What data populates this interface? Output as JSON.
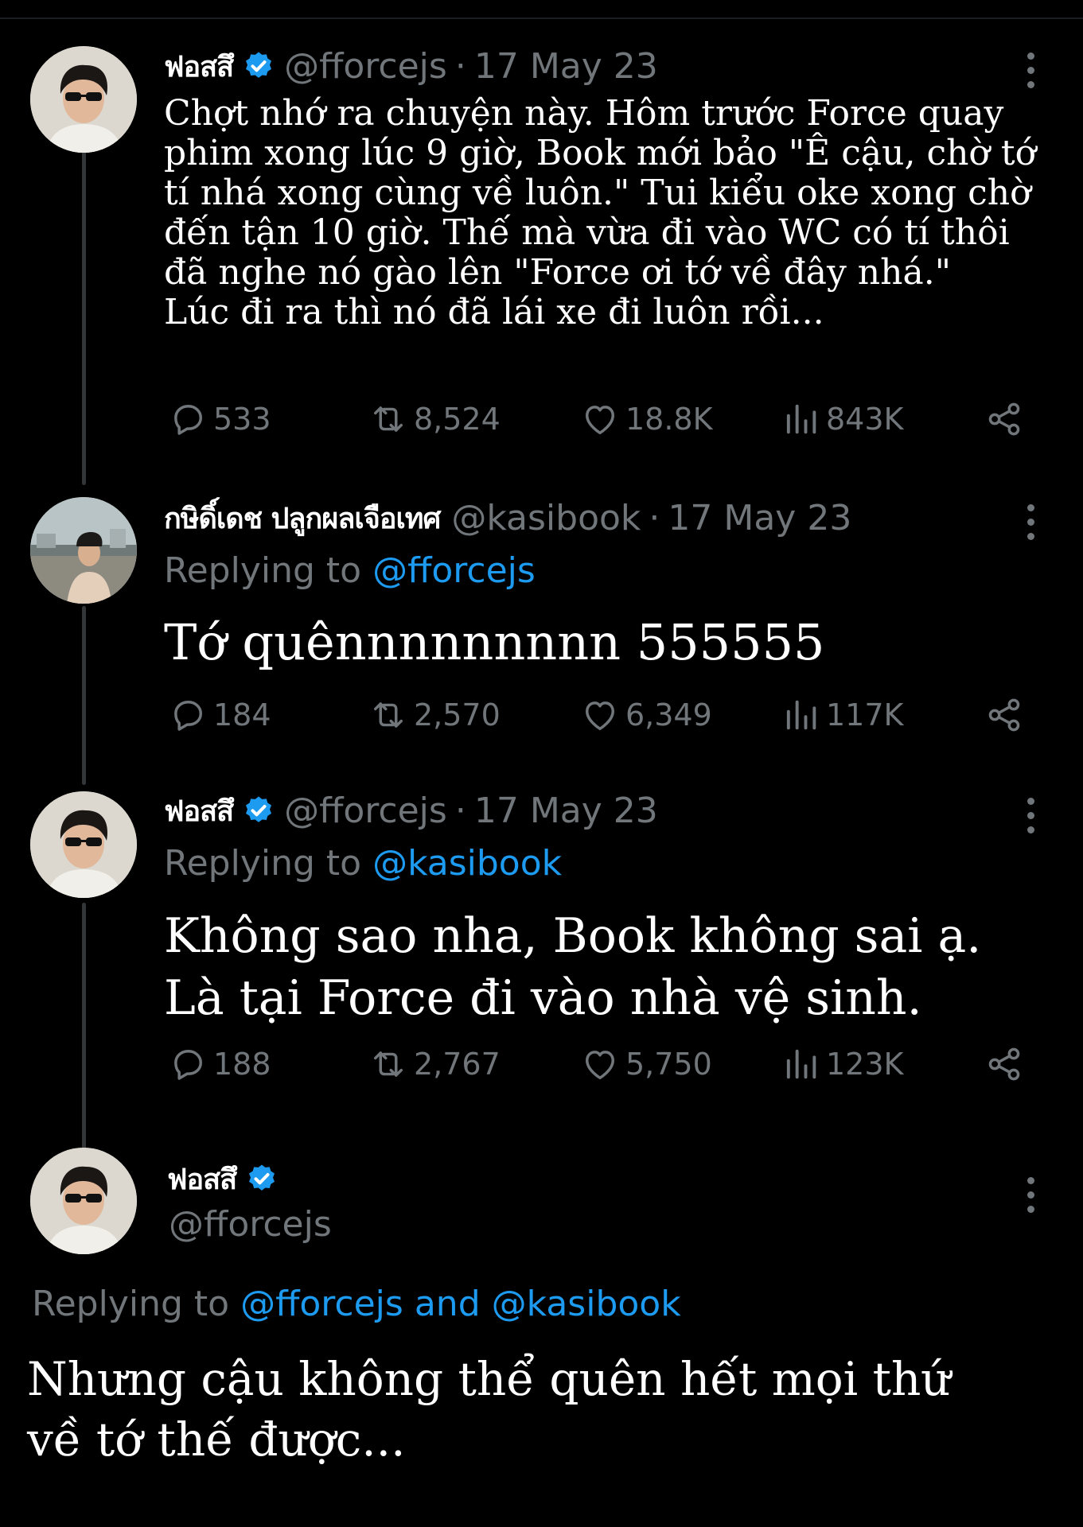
{
  "accent": "#1d9bf0",
  "background": "#000000",
  "tweets": [
    {
      "name": "ฟอสสึ",
      "handle": "@fforcejs",
      "date": "17 May 23",
      "verified": true,
      "text": "Chợt nhớ ra chuyện này. Hôm trước Force quay\nphim xong lúc 9 giờ, Book mới bảo \"Ê cậu, chờ tớ\ntí nhá xong cùng về luôn.\" Tui kiểu oke xong chờ\nđến tận 10 giờ. Thế mà vừa đi vào WC có tí thôi\nđã nghe nó gào lên \"Force ơi tớ về đây nhá.\"\nLúc đi ra thì nó đã lái xe đi luôn rồi...",
      "replies": "533",
      "retweets": "8,524",
      "likes": "18.8K",
      "views": "843K"
    },
    {
      "name": "กษิดิ์เดช ปลูกผลเจือเทศ",
      "handle": "@kasibook",
      "date": "17 May 23",
      "verified": false,
      "replying_label": "Replying to",
      "replying_to": "@fforcejs",
      "text": "Tớ quênnnnnnnnn 555555",
      "replies": "184",
      "retweets": "2,570",
      "likes": "6,349",
      "views": "117K"
    },
    {
      "name": "ฟอสสึ",
      "handle": "@fforcejs",
      "date": "17 May 23",
      "verified": true,
      "replying_label": "Replying to",
      "replying_to": "@kasibook",
      "text": "Không sao nha, Book không sai ạ.\nLà tại Force đi vào nhà vệ sinh.",
      "replies": "188",
      "retweets": "2,767",
      "likes": "5,750",
      "views": "123K"
    }
  ],
  "focus": {
    "name": "ฟอสสึ",
    "handle": "@fforcejs",
    "verified": true,
    "replying_label": "Replying to",
    "replying_to_1": "@fforcejs",
    "replying_and": "and",
    "replying_to_2": "@kasibook",
    "text": "Nhưng cậu không thể quên hết mọi thứ\nvề tớ thế được..."
  },
  "icons": {
    "reply": "reply-icon",
    "retweet": "retweet-icon",
    "like": "heart-icon",
    "views": "views-icon",
    "share": "share-icon",
    "more": "more-icon",
    "verified": "verified-badge-icon"
  }
}
